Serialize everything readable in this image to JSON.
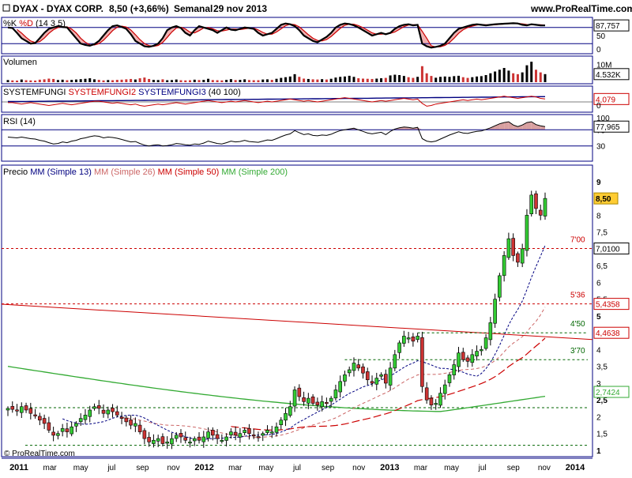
{
  "header": {
    "symbol": "DYAX - DYAX CORP.",
    "price_change": "8,50 (+3,66%)",
    "period": "Semanal",
    "date": "29 nov 2013",
    "brand": "www.ProRealTime.com"
  },
  "footer": {
    "copyright": "© ProRealTime.com"
  },
  "colors": {
    "frame": "#000080",
    "candle_up": "#33cc33",
    "candle_down": "#cc3333",
    "stoch_k": "#000000",
    "stoch_d": "#cc0000",
    "stoch_fill": "#f0b0b0",
    "rsi_fill": "#d8a0a0",
    "vol_up": "#000000",
    "vol_down": "#cc3333",
    "mm13": "#000080",
    "mm26": "#cc6666",
    "mm50": "#cc0000",
    "mm200": "#33aa33",
    "level_line": "#cc0000",
    "support_line": "#006600",
    "trend_line": "#cc0000"
  },
  "panels": {
    "stoch": {
      "title_k": "%K",
      "title_d": "%D",
      "params": "(14 3 5)",
      "last_value": "87,757"
    },
    "volume": {
      "title": "Volumen",
      "last_value": "4.532K",
      "scale_label": "10M"
    },
    "systemfungi": {
      "title1": "SYSTEMFUNGI",
      "title2": "SYSTEMFUNGI2",
      "title3": "SYSTEMFUNGI3",
      "params": "(40 100)",
      "last_value": "4,079"
    },
    "rsi": {
      "title": "RSI",
      "params": "(14)",
      "last_value": "77,965"
    },
    "price": {
      "title": "Precio",
      "legend": [
        {
          "mm": "MM",
          "label": "(Simple 13)",
          "color": "#000080"
        },
        {
          "mm": "MM",
          "label": "(Simple 26)",
          "color": "#cc6666"
        },
        {
          "mm": "MM",
          "label": "(Simple 50)",
          "color": "#cc0000"
        },
        {
          "mm": "MM",
          "label": "(Simple 200)",
          "color": "#33aa33"
        }
      ]
    }
  },
  "chart_data": {
    "type": "candlestick",
    "timeframe": "weekly",
    "last_price": 8.5,
    "x_labels": [
      {
        "label": "2011",
        "bold": true
      },
      {
        "label": "mar",
        "bold": false
      },
      {
        "label": "may",
        "bold": false
      },
      {
        "label": "jul",
        "bold": false
      },
      {
        "label": "sep",
        "bold": false
      },
      {
        "label": "nov",
        "bold": false
      },
      {
        "label": "2012",
        "bold": true
      },
      {
        "label": "mar",
        "bold": false
      },
      {
        "label": "may",
        "bold": false
      },
      {
        "label": "jul",
        "bold": false
      },
      {
        "label": "sep",
        "bold": false
      },
      {
        "label": "nov",
        "bold": false
      },
      {
        "label": "2013",
        "bold": true
      },
      {
        "label": "mar",
        "bold": false
      },
      {
        "label": "may",
        "bold": false
      },
      {
        "label": "jul",
        "bold": false
      },
      {
        "label": "sep",
        "bold": false
      },
      {
        "label": "nov",
        "bold": false
      },
      {
        "label": "2014",
        "bold": true
      }
    ],
    "price_axis": {
      "ylim": [
        1,
        9
      ],
      "ticks": [
        "1",
        "1,5",
        "2",
        "2,5",
        "3",
        "3,5",
        "4",
        "4,5",
        "5",
        "5,5",
        "6",
        "6,5",
        "7",
        "7,5",
        "8",
        "9"
      ]
    },
    "price_close": [
      2.25,
      2.22,
      2.18,
      2.3,
      2.2,
      2.1,
      2.05,
      1.9,
      1.8,
      1.6,
      1.45,
      1.5,
      1.65,
      1.55,
      1.7,
      1.8,
      1.95,
      2.05,
      2.2,
      2.3,
      2.25,
      2.1,
      2.2,
      2.15,
      2.05,
      1.95,
      1.85,
      1.75,
      1.8,
      1.55,
      1.35,
      1.25,
      1.3,
      1.35,
      1.2,
      1.25,
      1.35,
      1.45,
      1.4,
      1.3,
      1.25,
      1.35,
      1.3,
      1.4,
      1.55,
      1.45,
      1.35,
      1.3,
      1.4,
      1.55,
      1.45,
      1.5,
      1.6,
      1.5,
      1.45,
      1.4,
      1.5,
      1.6,
      1.55,
      1.7,
      1.9,
      2.1,
      2.3,
      2.8,
      2.6,
      2.45,
      2.55,
      2.4,
      2.35,
      2.45,
      2.4,
      2.55,
      2.8,
      3.05,
      3.25,
      3.4,
      3.6,
      3.45,
      3.3,
      3.1,
      3.0,
      3.15,
      3.25,
      3.0,
      3.45,
      3.85,
      4.2,
      4.4,
      4.35,
      4.25,
      4.4,
      2.9,
      2.5,
      2.35,
      2.4,
      2.7,
      2.95,
      3.25,
      3.55,
      3.9,
      3.7,
      3.65,
      3.85,
      3.95,
      4.0,
      4.35,
      4.8,
      5.5,
      6.2,
      6.8,
      7.3,
      6.8,
      6.6,
      7.0,
      8.0,
      8.6,
      8.2,
      8.0,
      8.5
    ],
    "levels": [
      {
        "label": "7'00",
        "price_label": "7,0100",
        "value": 7.01
      },
      {
        "label": "5'36",
        "price_label": "5,4358",
        "value": 5.36
      },
      {
        "label": "4'50",
        "price_label": "4,4638",
        "value": 4.5
      },
      {
        "label": "3'70",
        "price_label": "",
        "value": 3.7
      },
      {
        "label": "",
        "price_label": "2,7424",
        "value": 2.27
      }
    ],
    "stoch_axis": {
      "ticks": [
        "100",
        "50",
        "0"
      ],
      "ylim": [
        0,
        100
      ]
    },
    "stoch_k": [
      80,
      78,
      60,
      40,
      30,
      20,
      22,
      40,
      60,
      75,
      80,
      85,
      82,
      80,
      60,
      40,
      20,
      15,
      12,
      18,
      30,
      50,
      70,
      85,
      88,
      82,
      75,
      55,
      30,
      20,
      10,
      8,
      12,
      20,
      40,
      70,
      80,
      85,
      78,
      60,
      50,
      70,
      85,
      80,
      75,
      70,
      60,
      70,
      80,
      72,
      70,
      75,
      80,
      78,
      75,
      60,
      50,
      55,
      60,
      75,
      90,
      95,
      92,
      85,
      70,
      50,
      40,
      30,
      25,
      35,
      45,
      60,
      80,
      90,
      95,
      93,
      88,
      80,
      70,
      60,
      50,
      55,
      60,
      55,
      60,
      75,
      85,
      90,
      92,
      88,
      90,
      20,
      10,
      5,
      8,
      12,
      20,
      40,
      60,
      75,
      80,
      85,
      90,
      92,
      90,
      88,
      90,
      92,
      93,
      94,
      95,
      96,
      95,
      90,
      88,
      92,
      90,
      88,
      87.757
    ],
    "rsi_axis": {
      "ticks": [
        "100",
        "70",
        "30"
      ],
      "ylim": [
        0,
        100
      ]
    },
    "rsi": [
      52,
      51,
      50,
      52,
      50,
      48,
      47,
      44,
      42,
      38,
      35,
      36,
      40,
      38,
      42,
      44,
      48,
      50,
      53,
      55,
      54,
      50,
      52,
      51,
      49,
      46,
      43,
      40,
      41,
      36,
      32,
      30,
      32,
      33,
      30,
      31,
      33,
      36,
      35,
      33,
      32,
      35,
      34,
      37,
      42,
      39,
      36,
      35,
      38,
      42,
      40,
      41,
      44,
      41,
      40,
      39,
      42,
      45,
      44,
      48,
      53,
      57,
      60,
      68,
      63,
      58,
      60,
      56,
      55,
      57,
      56,
      59,
      64,
      68,
      70,
      72,
      74,
      70,
      66,
      62,
      60,
      62,
      64,
      58,
      66,
      72,
      75,
      77,
      76,
      74,
      76,
      48,
      42,
      40,
      42,
      47,
      52,
      57,
      61,
      65,
      62,
      61,
      64,
      66,
      67,
      71,
      75,
      80,
      85,
      88,
      90,
      82,
      78,
      82,
      88,
      90,
      83,
      80,
      77.965
    ],
    "volume_axis": {
      "ticks": [
        "10M"
      ]
    },
    "volume": [
      1.2,
      1.0,
      0.9,
      1.5,
      1.1,
      1.0,
      0.9,
      1.4,
      1.6,
      2.0,
      1.8,
      1.2,
      1.4,
      1.1,
      1.3,
      1.5,
      1.7,
      1.9,
      2.2,
      1.6,
      1.3,
      1.0,
      1.2,
      1.1,
      1.3,
      1.4,
      1.6,
      1.8,
      1.5,
      2.2,
      2.6,
      1.8,
      1.3,
      1.2,
      1.6,
      1.1,
      1.2,
      1.5,
      1.1,
      1.0,
      1.1,
      1.4,
      1.2,
      1.3,
      1.9,
      1.2,
      1.1,
      1.0,
      1.3,
      1.7,
      1.2,
      1.3,
      1.6,
      1.2,
      1.1,
      1.1,
      1.5,
      1.6,
      1.3,
      1.9,
      2.4,
      2.8,
      3.2,
      4.5,
      3.0,
      2.0,
      1.8,
      1.6,
      1.5,
      1.7,
      1.5,
      1.9,
      2.6,
      3.0,
      3.2,
      3.6,
      3.0,
      2.2,
      2.0,
      1.9,
      1.8,
      2.0,
      2.2,
      2.4,
      3.8,
      4.2,
      4.0,
      3.5,
      2.8,
      2.4,
      3.0,
      9.0,
      5.0,
      3.5,
      2.5,
      3.0,
      3.2,
      3.0,
      3.4,
      3.6,
      2.8,
      2.4,
      2.8,
      3.2,
      3.4,
      4.0,
      5.0,
      6.0,
      7.0,
      8.0,
      6.5,
      5.0,
      4.5,
      5.5,
      9.5,
      11.5,
      7.0,
      5.5,
      4.532
    ],
    "sf_axis": {
      "ticks": [
        "4,079",
        "0"
      ]
    },
    "sf_line1": [
      -1,
      -1,
      -2,
      -3,
      -2,
      -1,
      -2,
      -3,
      -4,
      -5,
      -4,
      -3,
      -2,
      -3,
      -4,
      -3,
      -2,
      -1,
      0,
      1,
      1,
      0,
      -1,
      -2,
      -1,
      -2,
      -3,
      -4,
      -3,
      -5,
      -6,
      -5,
      -4,
      -3,
      -4,
      -3,
      -2,
      -1,
      -2,
      -3,
      -2,
      -1,
      0,
      1,
      2,
      1,
      0,
      -1,
      0,
      1,
      0,
      1,
      2,
      1,
      0,
      -1,
      0,
      1,
      0,
      1,
      2,
      3,
      4,
      3,
      2,
      1,
      2,
      1,
      0,
      1,
      2,
      3,
      4,
      5,
      6,
      5,
      4,
      3,
      2,
      1,
      0,
      1,
      2,
      1,
      2,
      3,
      4,
      5,
      4,
      3,
      4,
      -2,
      -6,
      -5,
      -3,
      -2,
      -1,
      0,
      1,
      2,
      3,
      2,
      3,
      4,
      3,
      4,
      5,
      6,
      7,
      8,
      7,
      6,
      5,
      6,
      7,
      8,
      7,
      5,
      4.079
    ],
    "sf_line2": [
      1,
      1,
      1,
      1.2,
      1.2,
      1.3,
      1.3,
      1.4,
      1.5,
      1.6,
      1.7,
      1.8,
      1.9,
      2,
      2.1,
      2.2,
      2.3,
      2.4,
      2.5,
      2.6,
      2.7,
      2.8,
      2.9,
      3,
      3.1,
      3.2,
      3.3,
      3.4,
      3.5,
      3.6,
      3.7,
      3.8,
      3.9,
      4,
      4.1,
      4.2,
      4.3,
      4.4,
      4.5,
      4.6,
      4.7,
      4.8,
      4.9,
      5,
      5.1,
      5.2,
      5.3,
      5.4,
      5.5,
      5.6,
      5.7,
      5.8,
      5.9,
      6,
      6.1,
      6.2,
      6.3,
      6.4,
      6.5,
      6.6,
      6.7,
      6.8,
      6.9,
      7,
      7.1,
      7.2,
      7.3,
      7.4,
      7.5,
      7.6,
      7.7,
      7.8,
      7.9,
      8,
      8.1,
      8.2,
      8.3,
      8.4,
      8.5,
      8.6,
      8.7,
      8.8,
      8.9,
      9,
      9.1,
      9.2,
      9.3,
      9.4,
      9.5,
      9.6,
      9.7,
      9.8,
      9.9,
      10,
      10.1,
      10.2,
      10.3,
      10.4,
      10.5,
      10.6,
      10.7,
      10.8,
      10.9,
      11,
      11.1,
      11.2,
      11.3,
      11.4,
      11.5,
      11.6,
      11.7,
      11.8,
      11.9,
      12,
      12.1,
      12.2,
      12.3,
      12.4,
      12.5
    ]
  }
}
